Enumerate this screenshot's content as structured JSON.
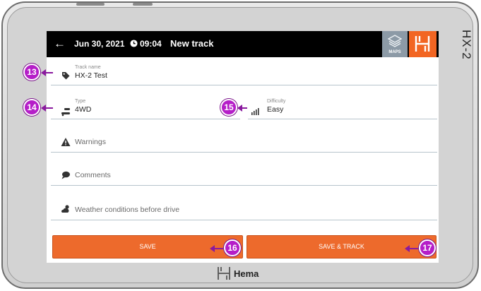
{
  "device": {
    "model": "HX-2"
  },
  "appbar": {
    "back_icon": "arrow-left-icon",
    "date": "Jun 30, 2021",
    "time": "09:04",
    "title": "New track",
    "maps_label": "MAPS"
  },
  "form": {
    "track_name": {
      "label": "Track name",
      "value": "HX-2 Test",
      "icon": "tag-icon"
    },
    "type": {
      "label": "Type",
      "value": "4WD",
      "icon": "vehicle-icon"
    },
    "difficulty": {
      "label": "Difficulty",
      "value": "Easy",
      "icon": "signal-bars-icon"
    },
    "warnings": {
      "placeholder": "Warnings",
      "icon": "warning-icon"
    },
    "comments": {
      "placeholder": "Comments",
      "icon": "comment-icon"
    },
    "weather": {
      "placeholder": "Weather conditions before drive",
      "icon": "weather-icon"
    }
  },
  "buttons": {
    "save": "SAVE",
    "save_track": "SAVE & TRACK"
  },
  "callouts": [
    "13",
    "14",
    "15",
    "16",
    "17"
  ],
  "footer": {
    "brand": "Hema"
  },
  "colors": {
    "accent": "#ED6A2C",
    "callout": "#B51EC8",
    "appbar": "#000000",
    "maps": "#8C9AA6"
  }
}
